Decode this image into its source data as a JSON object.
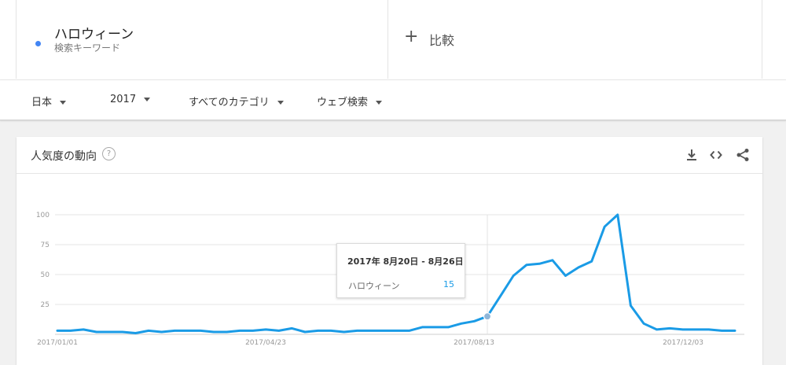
{
  "search_term": {
    "name": "ハロウィーン",
    "type": "検索キーワード",
    "dot_color": "#4285f4"
  },
  "compare": {
    "label": "比較",
    "icon": "plus-icon"
  },
  "filters": [
    {
      "label": "日本"
    },
    {
      "label": "2017"
    },
    {
      "label": "すべてのカテゴリ"
    },
    {
      "label": "ウェブ検索"
    }
  ],
  "card": {
    "title": "人気度の動向",
    "help_icon": "question-icon",
    "tools": [
      "download-icon",
      "embed-code-icon",
      "share-icon"
    ]
  },
  "tooltip": {
    "date_range": "2017年 8月20日 - 8月26日",
    "term": "ハロウィーン",
    "value": "15"
  },
  "chart_data": {
    "type": "line",
    "x_tick_labels": [
      "2017/01/01",
      "2017/04/23",
      "2017/08/13",
      "2017/12/03"
    ],
    "y_tick_labels": [
      "100",
      "75",
      "50",
      "25"
    ],
    "ylim": [
      0,
      100
    ],
    "grid": true,
    "series": [
      {
        "name": "ハロウィーン",
        "color": "#1a9be6",
        "values": [
          3,
          3,
          4,
          2,
          2,
          2,
          1,
          3,
          2,
          3,
          3,
          3,
          2,
          2,
          3,
          3,
          4,
          3,
          5,
          2,
          3,
          3,
          2,
          3,
          3,
          3,
          3,
          3,
          6,
          6,
          6,
          9,
          11,
          15,
          32,
          49,
          58,
          59,
          62,
          49,
          56,
          61,
          90,
          100,
          24,
          9,
          4,
          5,
          4,
          4,
          4,
          3,
          3
        ],
        "highlight_index": 33
      }
    ]
  }
}
